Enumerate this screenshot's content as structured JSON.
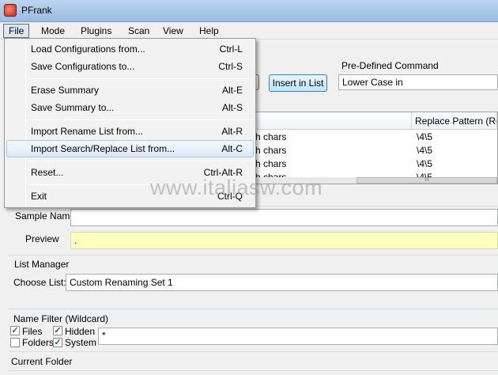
{
  "window": {
    "title": "PFrank"
  },
  "menubar": {
    "items": [
      "File",
      "Mode",
      "Plugins",
      "Scan",
      "View",
      "Help"
    ]
  },
  "file_menu": {
    "items": [
      {
        "label": "Load Configurations from...",
        "shortcut": "Ctrl-L"
      },
      {
        "label": "Save Configurations to...",
        "shortcut": "Ctrl-S"
      },
      {
        "label": "Erase Summary",
        "shortcut": "Alt-E"
      },
      {
        "label": "Save Summary to...",
        "shortcut": "Alt-S"
      },
      {
        "label": "Import Rename List from...",
        "shortcut": "Alt-R"
      },
      {
        "label": "Import Search/Replace List from...",
        "shortcut": "Alt-C"
      },
      {
        "label": "Reset...",
        "shortcut": "Ctrl-Alt-R"
      },
      {
        "label": "Exit",
        "shortcut": "Ctrl-Q"
      }
    ]
  },
  "command_panel": {
    "insert_button": "Insert in List",
    "predefined_label": "Pre-Defined Command",
    "predefined_value": "Lower Case in"
  },
  "table": {
    "headers": [
      "",
      "Replace Pattern (Regex)"
    ],
    "rows": [
      [
        "h chars",
        "\\4\\5"
      ],
      [
        "h chars",
        "\\4\\5"
      ],
      [
        "h chars",
        "\\4\\5"
      ],
      [
        "h chars",
        "\\4\\5"
      ]
    ],
    "scroll_grip": "III"
  },
  "sample": {
    "name_label": "Sample Name",
    "name_value": "",
    "preview_label": "Preview",
    "preview_value": "."
  },
  "list_manager": {
    "title": "List Manager",
    "choose_label": "Choose List:",
    "choose_value": "Custom Renaming Set 1"
  },
  "name_filter": {
    "title": "Name Filter (Wildcard)",
    "files_label": "Files",
    "files_checked": true,
    "folders_label": "Folders",
    "folders_checked": false,
    "hidden_label": "Hidden",
    "hidden_checked": true,
    "system_label": "System",
    "system_checked": true,
    "pattern_value": "*",
    "check_glyph": "✓"
  },
  "current_folder": {
    "title": "Current Folder"
  },
  "watermark": "www.italiasw.com"
}
